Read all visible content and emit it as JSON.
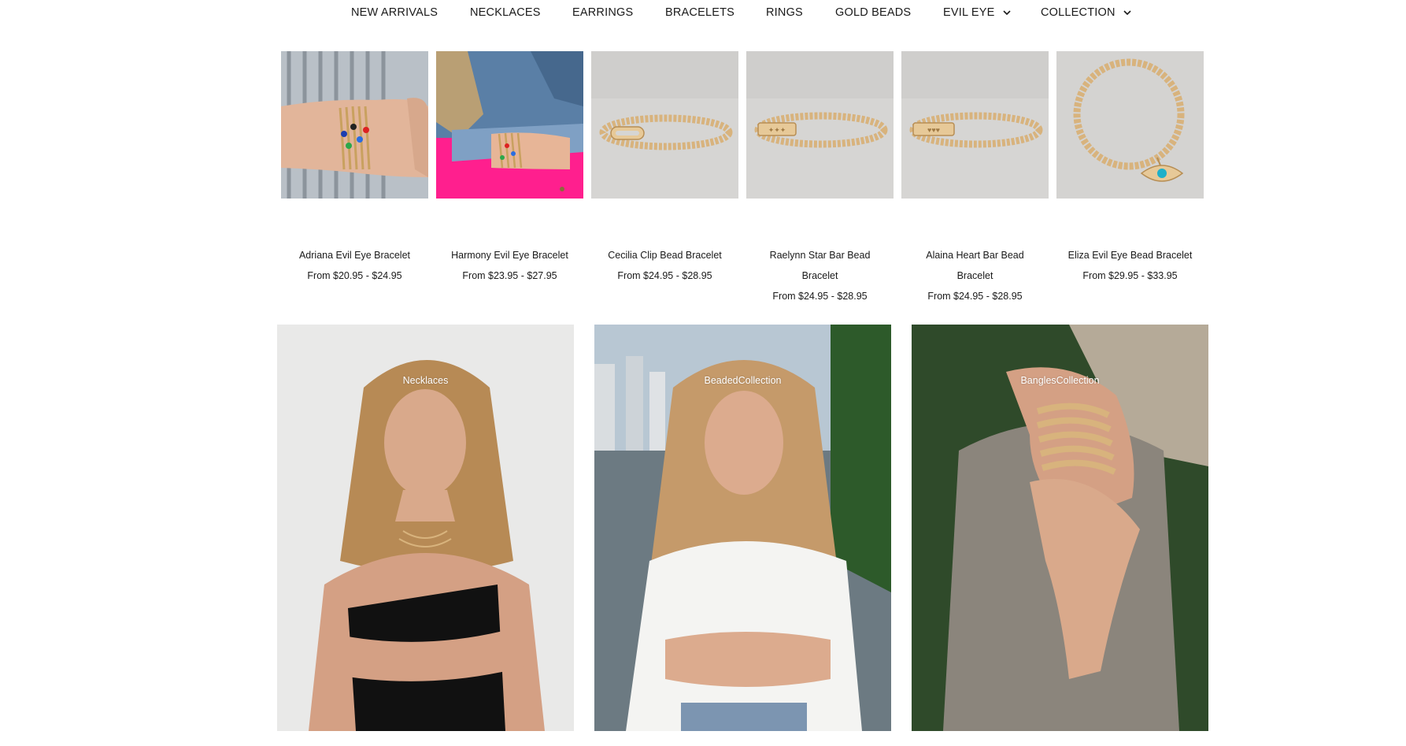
{
  "nav": {
    "items": [
      {
        "label": "NEW ARRIVALS",
        "dropdown": false
      },
      {
        "label": "NECKLACES",
        "dropdown": false
      },
      {
        "label": "EARRINGS",
        "dropdown": false
      },
      {
        "label": "BRACELETS",
        "dropdown": false
      },
      {
        "label": "RINGS",
        "dropdown": false
      },
      {
        "label": "GOLD BEADS",
        "dropdown": false
      },
      {
        "label": "EVIL EYE",
        "dropdown": true,
        "icon": "chevron-down-icon"
      },
      {
        "label": "COLLECTION",
        "dropdown": true,
        "icon": "chevron-down-icon"
      }
    ]
  },
  "products": [
    {
      "title_line1": "Adriana Evil Eye Bracelet",
      "title_line2": "",
      "price": "From $20.95 - $24.95"
    },
    {
      "title_line1": "Harmony Evil Eye Bracelet",
      "title_line2": "",
      "price": "From $23.95 - $27.95"
    },
    {
      "title_line1": "Cecilia Clip Bead Bracelet",
      "title_line2": "",
      "price": "From $24.95 - $28.95"
    },
    {
      "title_line1": "Raelynn Star Bar Bead",
      "title_line2": "Bracelet",
      "price": "From $24.95 - $28.95"
    },
    {
      "title_line1": "Alaina Heart Bar Bead",
      "title_line2": "Bracelet",
      "price": "From $24.95 - $28.95"
    },
    {
      "title_line1": "Eliza Evil Eye Bead Bracelet",
      "title_line2": "",
      "price": "From $29.95 - $33.95"
    }
  ],
  "collections": [
    {
      "label": "Necklaces"
    },
    {
      "label": "BeadedCollection"
    },
    {
      "label": "BanglesCollection"
    }
  ],
  "colors": {
    "text": "#1a1a1a",
    "gold": "#d6b07a",
    "pink": "#ff1f8e",
    "denim": "#5a7fa6"
  }
}
